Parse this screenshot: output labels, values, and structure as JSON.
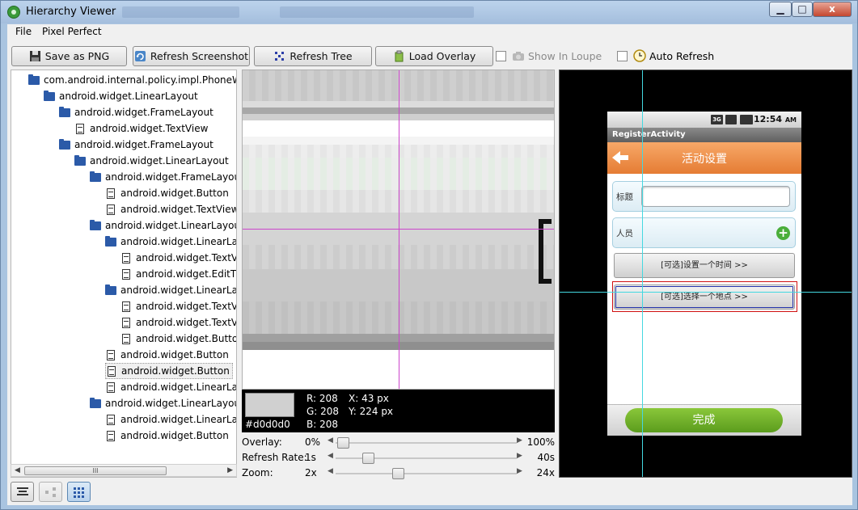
{
  "window": {
    "title": "Hierarchy Viewer",
    "controls": {
      "minimize": "▁",
      "maximize": "□",
      "close": "x"
    }
  },
  "menu": [
    "File",
    "Pixel Perfect"
  ],
  "toolbar": {
    "save_label": "Save as PNG",
    "refresh_screenshot_label": "Refresh Screenshot",
    "refresh_tree_label": "Refresh Tree",
    "load_overlay_label": "Load Overlay",
    "show_in_loupe_label": "Show In Loupe",
    "auto_refresh_label": "Auto Refresh"
  },
  "tree": {
    "nodes": [
      {
        "label": "com.android.internal.policy.impl.PhoneW",
        "depth": 0,
        "kind": "folder"
      },
      {
        "label": "android.widget.LinearLayout",
        "depth": 1,
        "kind": "folder"
      },
      {
        "label": "android.widget.FrameLayout",
        "depth": 2,
        "kind": "folder"
      },
      {
        "label": "android.widget.TextView",
        "depth": 3,
        "kind": "doc"
      },
      {
        "label": "android.widget.FrameLayout",
        "depth": 2,
        "kind": "folder"
      },
      {
        "label": "android.widget.LinearLayout",
        "depth": 3,
        "kind": "folder"
      },
      {
        "label": "android.widget.FrameLayou",
        "depth": 4,
        "kind": "folder"
      },
      {
        "label": "android.widget.Button",
        "depth": 5,
        "kind": "doc"
      },
      {
        "label": "android.widget.TextView",
        "depth": 5,
        "kind": "doc"
      },
      {
        "label": "android.widget.LinearLayou",
        "depth": 4,
        "kind": "folder"
      },
      {
        "label": "android.widget.LinearLa",
        "depth": 5,
        "kind": "folder"
      },
      {
        "label": "android.widget.TextV",
        "depth": 6,
        "kind": "doc"
      },
      {
        "label": "android.widget.EditT",
        "depth": 6,
        "kind": "doc"
      },
      {
        "label": "android.widget.LinearLa",
        "depth": 5,
        "kind": "folder"
      },
      {
        "label": "android.widget.TextV",
        "depth": 6,
        "kind": "doc"
      },
      {
        "label": "android.widget.TextV",
        "depth": 6,
        "kind": "doc"
      },
      {
        "label": "android.widget.Butto",
        "depth": 6,
        "kind": "doc"
      },
      {
        "label": "android.widget.Button",
        "depth": 5,
        "kind": "doc"
      },
      {
        "label": "android.widget.Button",
        "depth": 5,
        "kind": "doc",
        "selected": true
      },
      {
        "label": "android.widget.LinearLa",
        "depth": 5,
        "kind": "doc"
      },
      {
        "label": "android.widget.LinearLayou",
        "depth": 4,
        "kind": "folder"
      },
      {
        "label": "android.widget.LinearLa",
        "depth": 5,
        "kind": "doc"
      },
      {
        "label": "android.widget.Button",
        "depth": 5,
        "kind": "doc"
      }
    ],
    "scroll_grip": "III"
  },
  "pixel_info": {
    "hex": "#d0d0d0",
    "r": "R: 208",
    "g": "G: 208",
    "b": "B: 208",
    "x": "X: 43 px",
    "y": "Y: 224 px",
    "swatch_color": "#d0d0d0"
  },
  "sliders": {
    "overlay": {
      "label": "Overlay:",
      "min": "0%",
      "max": "100%",
      "value_fraction": 0
    },
    "refresh": {
      "label": "Refresh Rate:",
      "min": "1s",
      "max": "40s",
      "value_fraction": 0.15
    },
    "zoom": {
      "label": "Zoom:",
      "min": "2x",
      "max": "24x",
      "value_fraction": 0.33
    }
  },
  "phone": {
    "status_time": "12:54",
    "status_ampm": "AM",
    "status_network": "3G",
    "activity_title": "RegisterActivity",
    "header_title": "活动设置",
    "title_label": "标题",
    "people_label": "人员",
    "time_button": "[可选]设置一个时间  >>",
    "place_button": "[可选]选择一个地点  >>",
    "done_button": "完成"
  },
  "colors": {
    "accent_orange": "#e57c34",
    "done_green": "#6aab26",
    "crosshair_magenta": "#cc44cc",
    "crosshair_cyan": "#44d8e0",
    "selection_red": "#d01010",
    "selection_blue": "#2233aa"
  },
  "icons": [
    "save-icon",
    "refresh-icon",
    "tree-icon",
    "overlay-icon",
    "loupe-icon",
    "auto-refresh-icon",
    "list-view-icon",
    "tree-view-icon",
    "pixel-perfect-icon"
  ]
}
